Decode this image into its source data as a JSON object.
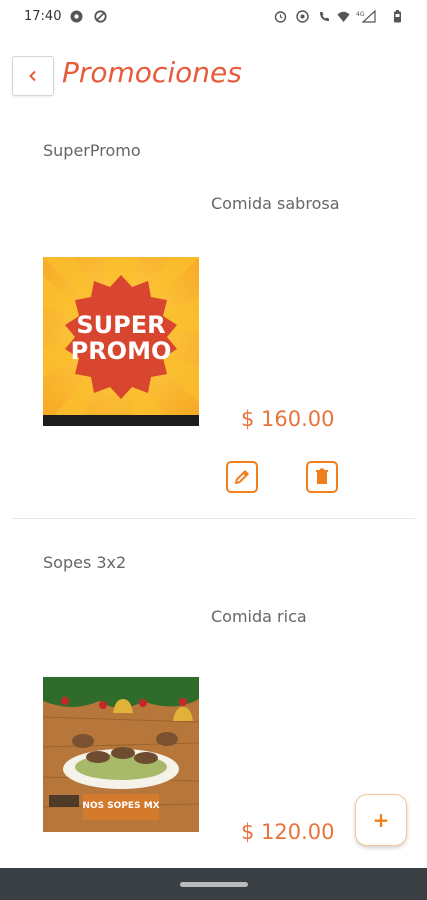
{
  "status_bar": {
    "time": "17:40",
    "left_icons": [
      "gear-notification-icon",
      "sync-notification-icon"
    ],
    "right_icons": [
      "alarm-icon",
      "eye-icon",
      "wifi-call-icon",
      "wifi-icon",
      "signal-icon",
      "battery-icon"
    ],
    "network_label": "4G"
  },
  "header": {
    "title": "Promociones",
    "back_icon": "chevron-left-icon"
  },
  "promotions": [
    {
      "name": "SuperPromo",
      "description": "Comida sabrosa",
      "image_text_line1": "SUPER",
      "image_text_line2": "PROMO",
      "price": "$ 160.00",
      "edit_icon": "pencil-icon",
      "delete_icon": "trash-icon"
    },
    {
      "name": "Sopes 3x2",
      "description": "Comida rica",
      "image_text": "NOS SOPES MX",
      "price": "$ 120.00"
    }
  ],
  "fab": {
    "label": "+",
    "icon": "plus-icon"
  },
  "colors": {
    "accent": "#e85a3a",
    "orange": "#ef7f1a",
    "price": "#e8743b",
    "nav": "#3a3f43"
  }
}
